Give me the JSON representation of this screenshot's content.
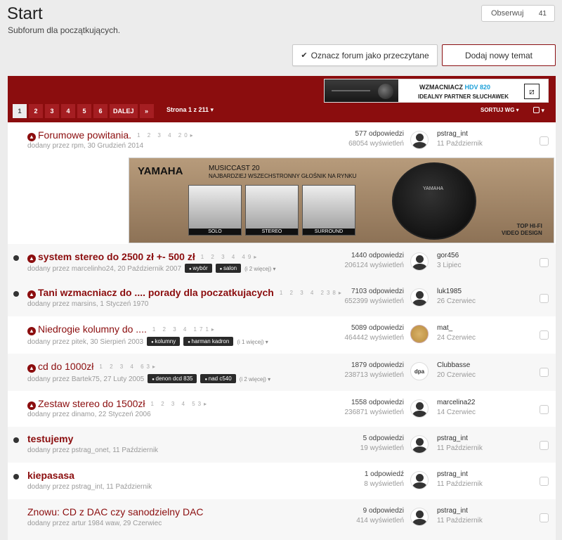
{
  "header": {
    "title": "Start",
    "subtitle": "Subforum dla początkujących.",
    "follow_label": "Obserwuj",
    "follow_count": "41"
  },
  "actions": {
    "mark_read": "Oznacz forum jako przeczytane",
    "new_topic": "Dodaj nowy temat"
  },
  "top_ad": {
    "line1_prefix": "WZMACNIACZ",
    "line1_model": "HDV 820",
    "line2": "IDEALNY PARTNER SŁUCHAWEK"
  },
  "pagination": {
    "pages": [
      "1",
      "2",
      "3",
      "4",
      "5",
      "6"
    ],
    "next": "DALEJ",
    "last": "»",
    "page_info": "Strona 1 z 211 ▾",
    "sort": "SORTUJ WG ▾"
  },
  "banner": {
    "brand": "YAMAHA",
    "product": "MUSICCAST 20",
    "tagline": "NAJBARDZIEJ WSZECHSTRONNY GŁOŚNIK NA RYNKU",
    "thumbs": [
      "SOLO",
      "STEREO",
      "SURROUND"
    ],
    "dealer_line1": "TOP HI-FI",
    "dealer_line2": "VIDEO DESIGN"
  },
  "topics": [
    {
      "title": "Forumowe powitania.",
      "pages": "1 2 3 4 20▸",
      "meta": "dodany przez rpm, 30 Grudzień 2014",
      "replies": "577 odpowiedzi",
      "views": "68054 wyświetleń",
      "last_user": "pstrag_int",
      "last_date": "11 Październik"
    },
    {
      "title": "system stereo do 2500 zł +- 500 zł",
      "pages": "1 2 3 4 49▸",
      "meta": "dodany przez marcelinho24, 20 Październik 2007",
      "tags": [
        "wybór",
        "salon"
      ],
      "more": "(i 2 więcej) ▾",
      "replies": "1440 odpowiedzi",
      "views": "206124 wyświetleń",
      "last_user": "gor456",
      "last_date": "3 Lipiec"
    },
    {
      "title": "Tani wzmacniacz do .... porady dla poczatkujacych",
      "pages": "1 2 3 4 238▸",
      "meta": "dodany przez marsins, 1 Styczeń 1970",
      "replies": "7103 odpowiedzi",
      "views": "652399 wyświetleń",
      "last_user": "luk1985",
      "last_date": "26 Czerwiec"
    },
    {
      "title": "Niedrogie kolumny do ....",
      "pages": "1 2 3 4 171▸",
      "meta": "dodany przez pitek, 30 Sierpień 2003",
      "tags": [
        "kolumny",
        "harman kadron"
      ],
      "more": "(i 1 więcej) ▾",
      "replies": "5089 odpowiedzi",
      "views": "464442 wyświetleń",
      "last_user": "mat_",
      "last_date": "24 Czerwiec"
    },
    {
      "title": "cd do 1000zł",
      "pages": "1 2 3 4 63▸",
      "meta": "dodany przez Bartek75, 27 Luty 2005",
      "tags": [
        "denon dcd 835",
        "nad c540"
      ],
      "more": "(i 2 więcej) ▾",
      "replies": "1879 odpowiedzi",
      "views": "238713 wyświetleń",
      "last_user": "Clubbasse",
      "last_date": "20 Czerwiec",
      "avatar_text": "dpa"
    },
    {
      "title": "Zestaw stereo do 1500zł",
      "pages": "1 2 3 4 53▸",
      "meta": "dodany przez dinamo, 22 Styczeń 2006",
      "replies": "1558 odpowiedzi",
      "views": "236871 wyświetleń",
      "last_user": "marcelina22",
      "last_date": "14 Czerwiec"
    },
    {
      "title": "testujemy",
      "meta": "dodany przez pstrag_onet, 11 Październik",
      "replies": "5 odpowiedzi",
      "views": "19 wyświetleń",
      "last_user": "pstrag_int",
      "last_date": "11 Październik"
    },
    {
      "title": "kiepasasa",
      "meta": "dodany przez pstrag_int, 11 Październik",
      "replies": "1 odpowiedź",
      "views": "8 wyświetleń",
      "last_user": "pstrag_int",
      "last_date": "11 Październik"
    },
    {
      "title": "Znowu: CD z DAC czy sanodzielny DAC",
      "meta": "dodany przez artur 1984 waw, 29 Czerwiec",
      "replies": "9 odpowiedzi",
      "views": "414 wyświetleń",
      "last_user": "pstrag_int",
      "last_date": "11 Październik"
    }
  ]
}
